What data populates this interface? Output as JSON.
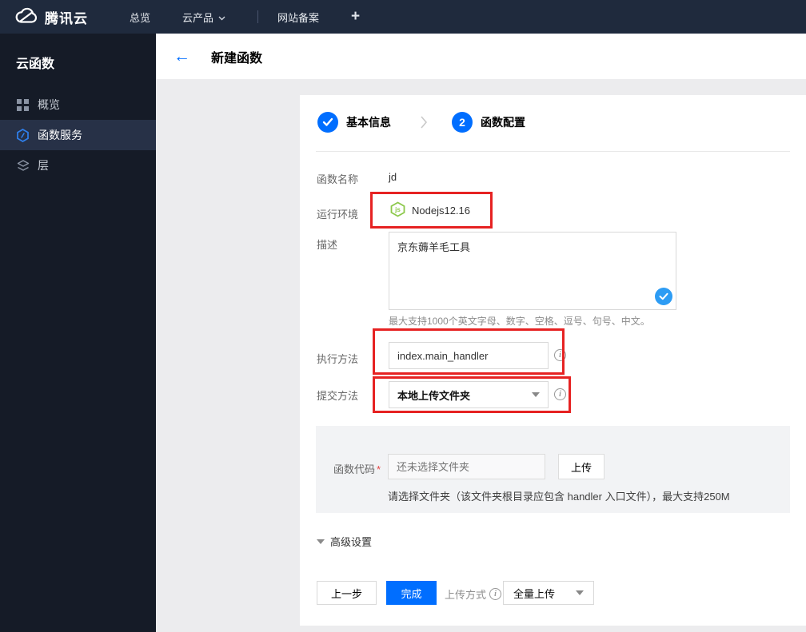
{
  "topbar": {
    "brand": "腾讯云",
    "items": [
      {
        "label": "总览"
      },
      {
        "label": "云产品"
      },
      {
        "label": "网站备案"
      },
      {
        "label": "+"
      }
    ]
  },
  "sidebar": {
    "title": "云函数",
    "items": [
      {
        "label": "概览",
        "icon": "grid-icon",
        "active": false
      },
      {
        "label": "函数服务",
        "icon": "function-service-icon",
        "active": true
      },
      {
        "label": "层",
        "icon": "layers-icon",
        "active": false
      }
    ]
  },
  "header": {
    "back": "←",
    "title": "新建函数"
  },
  "stepper": {
    "step1": {
      "label": "基本信息",
      "state": "done"
    },
    "step2": {
      "label": "函数配置",
      "number": "2",
      "state": "current"
    }
  },
  "form": {
    "function_name": {
      "label": "函数名称",
      "value": "jd"
    },
    "runtime": {
      "label": "运行环境",
      "value": "Nodejs12.16",
      "icon": "nodejs-icon"
    },
    "description": {
      "label": "描述",
      "value": "京东薅羊毛工具",
      "hint": "最大支持1000个英文字母、数字、空格、逗号、句号、中文。"
    },
    "handler": {
      "label": "执行方法",
      "value": "index.main_handler"
    },
    "submit_method": {
      "label": "提交方法",
      "value": "本地上传文件夹"
    },
    "function_code": {
      "label": "函数代码",
      "required_mark": "*",
      "placeholder": "还未选择文件夹",
      "upload_button": "上传",
      "hint": "请选择文件夹（该文件夹根目录应包含 handler 入口文件），最大支持250M"
    }
  },
  "advanced": {
    "label": "高级设置"
  },
  "footer": {
    "prev_button": "上一步",
    "finish_button": "完成",
    "upload_mode_label": "上传方式",
    "upload_mode_value": "全量上传"
  },
  "colors": {
    "accent_blue": "#006eff",
    "check_badge_blue": "#2d9cf4",
    "node_green": "#8cc84b",
    "annotation_red": "#e62222",
    "topbar_bg": "#1f2a3d",
    "sidebar_bg": "#151b27"
  }
}
